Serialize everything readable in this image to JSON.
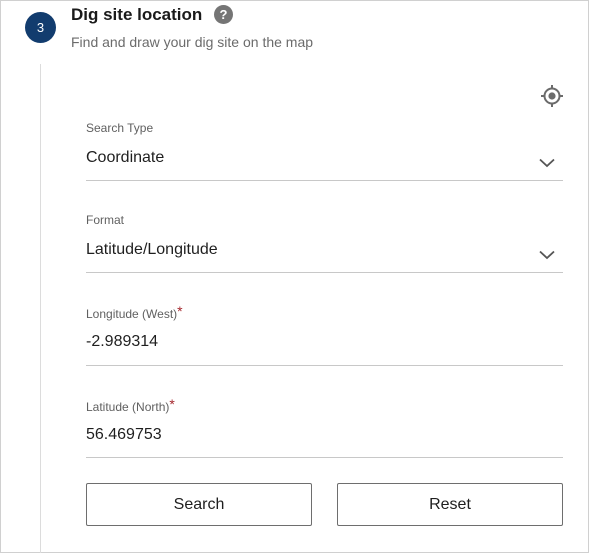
{
  "step": {
    "number": "3",
    "title": "Dig site location",
    "help_icon": "?",
    "subtitle": "Find and draw your dig site on the map"
  },
  "locate_icon": "crosshair-locate-icon",
  "form": {
    "search_type": {
      "label": "Search Type",
      "value": "Coordinate"
    },
    "format": {
      "label": "Format",
      "value": "Latitude/Longitude"
    },
    "longitude": {
      "label": "Longitude (West)",
      "required_marker": "*",
      "value": "-2.989314"
    },
    "latitude": {
      "label": "Latitude (North)",
      "required_marker": "*",
      "value": "56.469753"
    }
  },
  "buttons": {
    "search_label": "Search",
    "reset_label": "Reset"
  },
  "colors": {
    "step_badge": "#123c6e",
    "required_marker": "#a4262c",
    "help_icon": "#757575"
  }
}
